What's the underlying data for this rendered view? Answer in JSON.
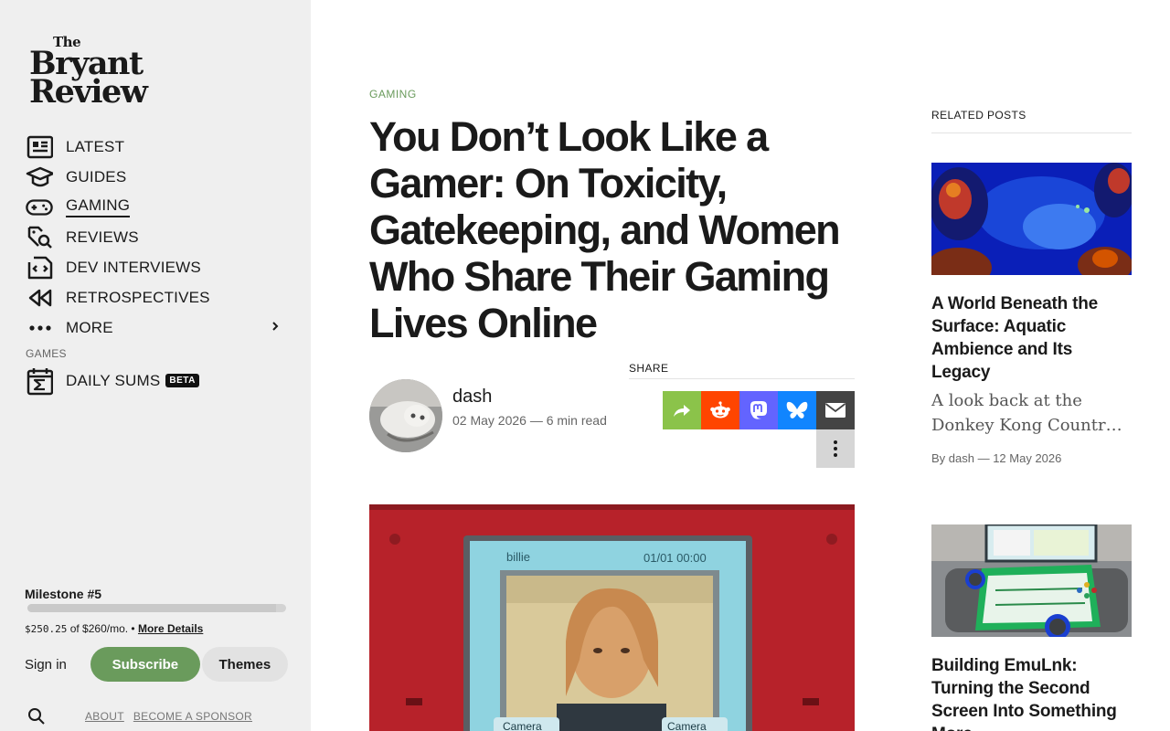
{
  "site": {
    "logo_the": "The",
    "logo_line1": "Bryant",
    "logo_line2": "Review"
  },
  "nav": {
    "items": [
      {
        "label": "LATEST",
        "icon": "newspaper-icon"
      },
      {
        "label": "GUIDES",
        "icon": "graduation-cap-icon"
      },
      {
        "label": "GAMING",
        "icon": "gamepad-icon",
        "active": true
      },
      {
        "label": "REVIEWS",
        "icon": "tag-search-icon"
      },
      {
        "label": "DEV INTERVIEWS",
        "icon": "code-file-icon"
      },
      {
        "label": "RETROSPECTIVES",
        "icon": "rewind-icon"
      },
      {
        "label": "MORE",
        "icon": "ellipsis-icon"
      }
    ],
    "section_label": "GAMES",
    "games": [
      {
        "label": "DAILY SUMS",
        "badge": "BETA",
        "icon": "calendar-sigma-icon"
      }
    ]
  },
  "milestone": {
    "title": "Milestone #5",
    "raised": "$250.25",
    "goal_text": "of $260/mo.",
    "separator": "•",
    "details_link": "More Details",
    "progress": 0.96
  },
  "account": {
    "signin": "Sign in",
    "subscribe": "Subscribe",
    "themes": "Themes"
  },
  "footer": {
    "about": "ABOUT",
    "sponsor": "BECOME A SPONSOR"
  },
  "article": {
    "category": "GAMING",
    "title": "You Don’t Look Like a Gamer: On Toxicity, Gatekeeping, and Women Who Share Their Gaming Lives Online",
    "author": "dash",
    "meta": "02 May 2026 — 6 min read",
    "share_label": "SHARE",
    "hero_text_name": "billie",
    "hero_text_date": "01/01  00:00",
    "hero_text_cam1": "Camera",
    "hero_text_cam2": "Camera"
  },
  "related": {
    "label": "RELATED POSTS",
    "posts": [
      {
        "title": "A World Beneath the Surface: Aquatic Ambience and Its Legacy",
        "excerpt_line1": "A look back at the",
        "excerpt_line2": "Donkey Kong Countr…",
        "byline": "By dash — 12 May 2026"
      },
      {
        "title": "Building EmuLnk: Turning the Second Screen Into Something More"
      }
    ]
  },
  "colors": {
    "accent_green": "#6a9b5c",
    "share_green": "#8bc34a",
    "reddit": "#ff4500",
    "mastodon": "#6364ff",
    "bluesky": "#1185fe",
    "email": "#444444"
  }
}
